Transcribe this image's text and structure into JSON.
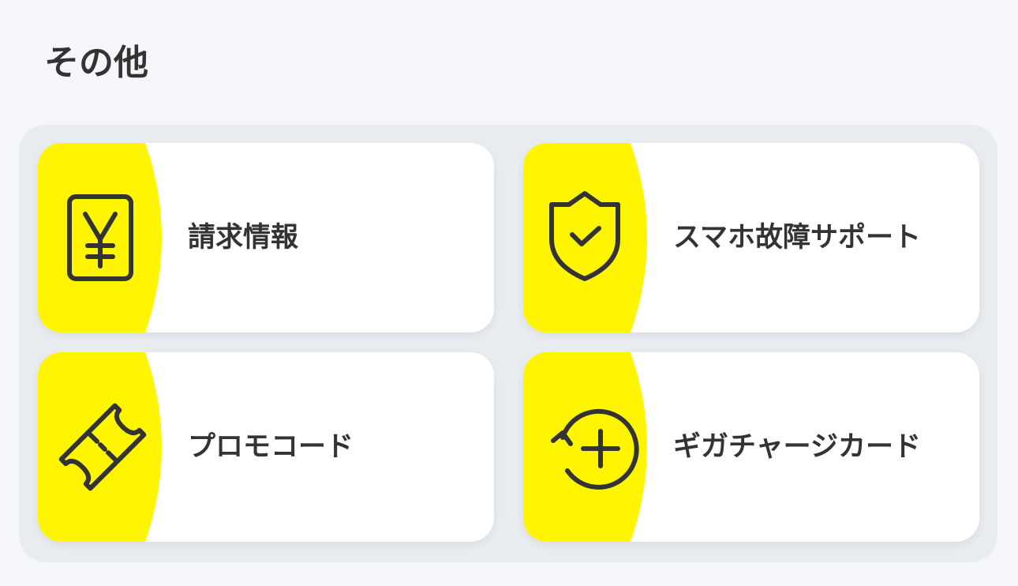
{
  "section": {
    "title": "その他"
  },
  "colors": {
    "accent": "#fff500",
    "text": "#333333",
    "card": "#ffffff",
    "panel": "#e8ebef",
    "background": "#f5f6fa"
  },
  "menu": {
    "items": [
      {
        "label": "請求情報",
        "icon": "yen-receipt-icon"
      },
      {
        "label": "スマホ故障サポート",
        "icon": "shield-check-icon"
      },
      {
        "label": "プロモコード",
        "icon": "ticket-icon"
      },
      {
        "label": "ギガチャージカード",
        "icon": "refresh-plus-icon"
      }
    ]
  }
}
